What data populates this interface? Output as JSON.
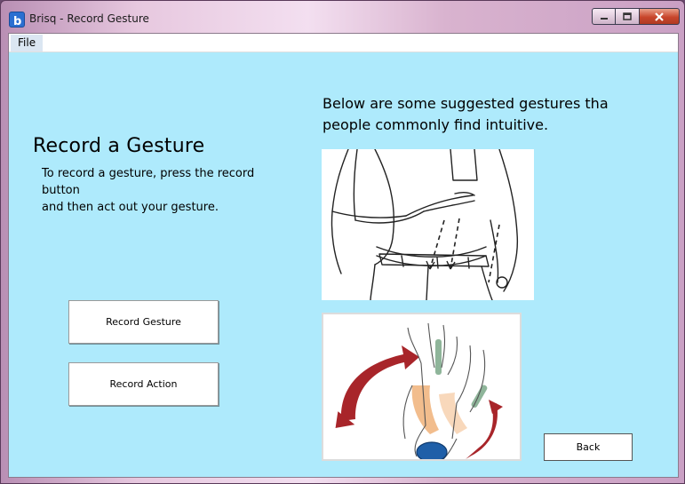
{
  "window": {
    "title": "Brisq - Record Gesture",
    "icon": "brisq-app-icon"
  },
  "menu": {
    "file_label": "File"
  },
  "left": {
    "heading": "Record a Gesture",
    "instructions": [
      "To record a gesture, press the record",
      "button",
      "and then act out your gesture."
    ]
  },
  "right": {
    "suggest_lines": [
      "Below are some suggested gestures tha",
      "people commonly find intuitive."
    ]
  },
  "buttons": {
    "record_gesture": "Record Gesture",
    "record_action": "Record Action",
    "back": "Back"
  },
  "colors": {
    "background": "#aeeafc",
    "arrow_red": "#a8252a",
    "finger_green": "#8fb59a",
    "hand_orange": "#f0b27a",
    "ball_blue": "#1f5fa8"
  }
}
